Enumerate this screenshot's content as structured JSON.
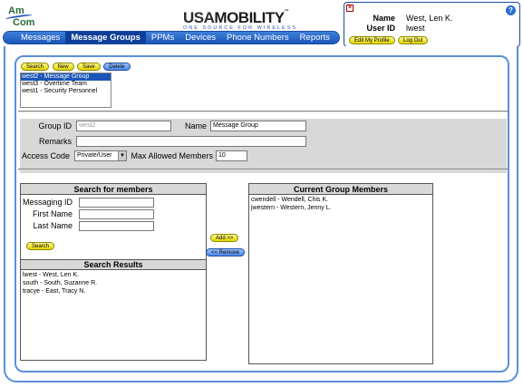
{
  "header": {
    "amcom_logo": {
      "am": "Am",
      "com": "Com"
    },
    "usa_logo": {
      "brand_a": "USA",
      "brand_b": "MOBILITY",
      "tagline": "ONE SOURCE FOR WIRELESS"
    },
    "nav": [
      {
        "label": "Messages",
        "active": false
      },
      {
        "label": "Message Groups",
        "active": true
      },
      {
        "label": "PPMs",
        "active": false
      },
      {
        "label": "Devices",
        "active": false
      },
      {
        "label": "Phone Numbers",
        "active": false
      },
      {
        "label": "Reports",
        "active": false
      }
    ],
    "user": {
      "name_label": "Name",
      "name_value": "West, Len K.",
      "userid_label": "User ID",
      "userid_value": "lwest",
      "edit_profile": "Edit My Profile",
      "logout": "Log Out"
    }
  },
  "toolbar": {
    "search": "Search",
    "new": "New",
    "save": "Save",
    "delete": "Delete"
  },
  "group_list": {
    "items": [
      {
        "label": "west2 - Message Group",
        "selected": true
      },
      {
        "label": "west3 - Overtime Team",
        "selected": false
      },
      {
        "label": "west1 - Security Personnel",
        "selected": false
      }
    ]
  },
  "detail": {
    "group_id_label": "Group ID",
    "group_id_value": "west2",
    "name_label": "Name",
    "name_value": "Message Group",
    "remarks_label": "Remarks",
    "remarks_value": "",
    "access_code_label": "Access Code",
    "access_code_value": "Private/User",
    "max_members_label": "Max Allowed Members",
    "max_members_value": "10"
  },
  "search_members": {
    "title": "Search for members",
    "messaging_id_label": "Messaging ID",
    "first_name_label": "First Name",
    "last_name_label": "Last Name",
    "search_button": "Search"
  },
  "search_results": {
    "title": "Search Results",
    "items": [
      "lwest - West, Len K.",
      "south - South, Suzanne R.",
      "tracye - East, Tracy N."
    ]
  },
  "move": {
    "add": "Add >>",
    "remove": "<< Remove"
  },
  "current_members": {
    "title": "Current Group Members",
    "items": [
      "cwendell - Wendell, Chis K.",
      "jwestern - Western, Jenny L."
    ]
  }
}
